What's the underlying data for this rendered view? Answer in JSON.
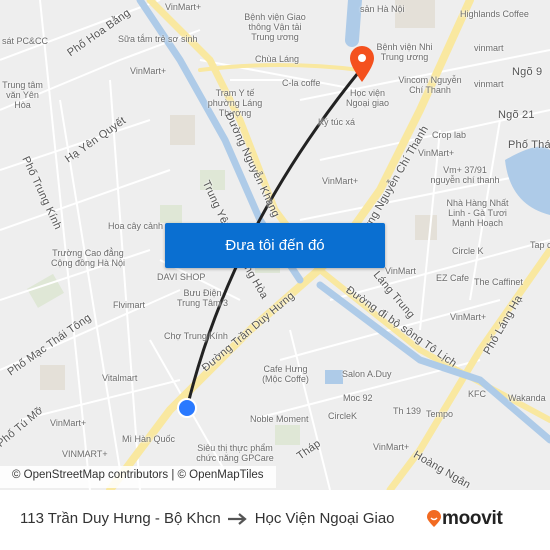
{
  "map": {
    "labels": [
      "Phố Hoa Bằng",
      "Sữa tắm trẻ sơ sinh",
      "VinMart+",
      "Bệnh viện Giao thông Vận tải Trung ương",
      "Chùa Láng",
      "C-la coffe",
      "Trạm Y tế phường Láng Thượng",
      "Học viện Ngoại giao",
      "Ký túc xá",
      "Bệnh viện Nhi Trung ương",
      "Highlands Coffee",
      "vinmart",
      "Ngõ 9",
      "Vincom Nguyễn Chí Thanh",
      "vinmart",
      "Ngõ 21",
      "Phố Thái",
      "Crop lab",
      "VinMart+",
      "Vm+ 37/91 nguyễn chí thanh",
      "Nhà Hàng Nhất Linh - Gà Tươi Mạnh Hoạch",
      "Circle K",
      "EZ Cafe",
      "The Caffinet",
      "VinMart",
      "VinMart+",
      "VinMart+",
      "Hoa cây cảnh",
      "Trường Cao đẳng Cộng đồng Hà Nội",
      "DAVI SHOP",
      "Bưu Điện Trung Tâm 3",
      "Flvimart",
      "Chợ Trung Kính",
      "Vitalmart",
      "VinMart+",
      "Mì Hàn Quốc",
      "VINMART+",
      "Siêu thị thực phẩm chức năng GPCare",
      "Cafe Hưng (Mộc Coffe)",
      "Salon A.Duy",
      "Moc 92",
      "Noble Moment",
      "CircleK",
      "Th 139",
      "Tempo",
      "KFC",
      "Wakanda",
      "VinMart+",
      "VinMart+",
      "sát PC&CC",
      "Trung tâm văn Yên Hòa",
      "sản Hà Nội",
      "Tap c"
    ],
    "streets": [
      "Phố Hoa Bằng",
      "Hạ Yên Quyết",
      "Phố Trung Kính",
      "Đường Nguyễn Khang",
      "Trung Yên",
      "Trung Hòa",
      "Đường Trần Duy Hưng",
      "Đường Nguyễn Chí Thanh",
      "Láng Trung",
      "Đường đi bộ sông Tô Lịch",
      "Phố Láng Hạ",
      "Phố Mạc Thái Tông",
      "Phố Tú Mỡ",
      "Hoàng Ngân",
      "Tháp"
    ],
    "cta_label": "Đưa tôi đến đó",
    "attribution": "© OpenStreetMap contributors | © OpenMapTiles",
    "origin_color": "#2979ff",
    "destination_color": "#f4511e"
  },
  "footer": {
    "origin": "113 Trần Duy Hưng - Bộ Khcn",
    "destination": "Học Viện Ngoại Giao",
    "brand": "moovit",
    "brand_color": "#f26a21"
  }
}
